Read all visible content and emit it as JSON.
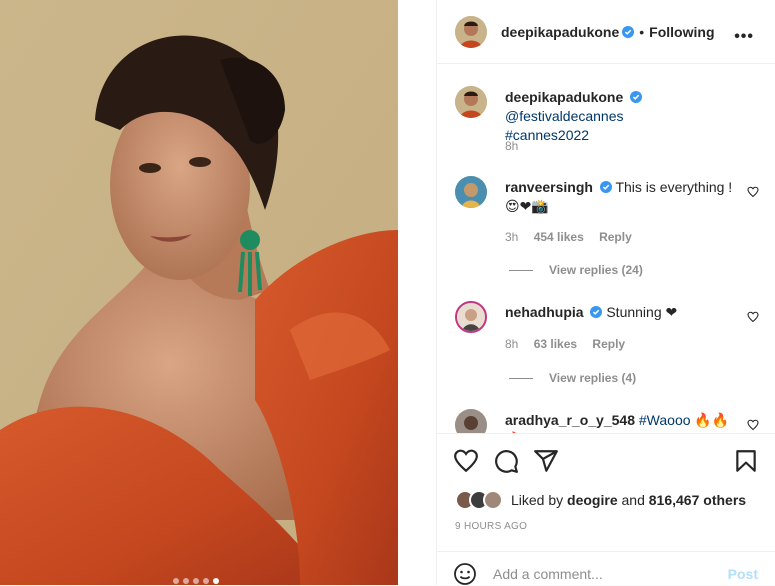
{
  "post": {
    "author": "deepikapadukone",
    "follow_state": "Following",
    "more_icon": "more-horizontal-icon",
    "separator": "•",
    "media": {
      "type": "photo",
      "current_slide": 5,
      "total_slides": 5
    }
  },
  "caption": {
    "username": "deepikapadukone",
    "mention": "@festivaldecannes",
    "hashtag": "#cannes2022",
    "time": "8h"
  },
  "comments": [
    {
      "username": "ranveersingh",
      "verified": true,
      "text": "This is everything !",
      "text_line2": "😍❤📸",
      "time": "3h",
      "likes": "454 likes",
      "reply": "Reply",
      "view_replies": "View replies (24)"
    },
    {
      "username": "nehadhupia",
      "verified": true,
      "text": "Stunning ❤",
      "time": "8h",
      "likes": "63 likes",
      "reply": "Reply",
      "view_replies": "View replies (4)"
    },
    {
      "username": "aradhya_r_o_y_548",
      "verified": false,
      "text": "#Waooo",
      "suffix": "🔥🔥🔥"
    }
  ],
  "actions": {
    "like_icon": "heart-icon",
    "comment_icon": "comment-icon",
    "share_icon": "send-icon",
    "save_icon": "bookmark-icon"
  },
  "likes_summary": {
    "prefix": "Liked by",
    "user": "deogire",
    "middle": "and",
    "count": "816,467 others"
  },
  "timestamp": "9 HOURS AGO",
  "add_comment": {
    "placeholder": "Add a comment...",
    "post_label": "Post",
    "emoji_icon": "smiley-icon"
  },
  "colors": {
    "verified": "#3897f0",
    "link": "#00376b",
    "muted": "#8e8e8e",
    "post_disabled": "#b2dffc",
    "gown": "#c4471f"
  }
}
